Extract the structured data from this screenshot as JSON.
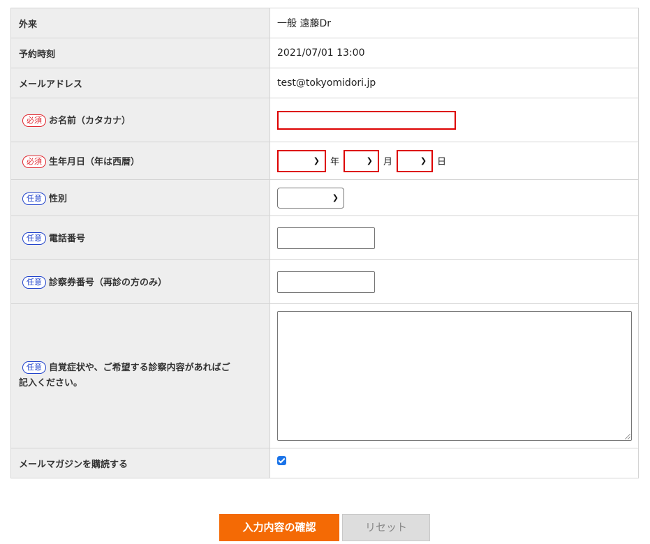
{
  "badges": {
    "required": "必須",
    "optional": "任意"
  },
  "rows": {
    "outpatient": {
      "label": "外来",
      "value": "一般 遠藤Dr"
    },
    "appointment_time": {
      "label": "予約時刻",
      "value": "2021/07/01 13:00"
    },
    "email": {
      "label": "メールアドレス",
      "value": "test@tokyomidori.jp"
    },
    "name_kana": {
      "label": "お名前（カタカナ）",
      "value": ""
    },
    "birthdate": {
      "label": "生年月日（年は西暦）",
      "year_unit": "年",
      "month_unit": "月",
      "day_unit": "日"
    },
    "gender": {
      "label": "性別"
    },
    "phone": {
      "label": "電話番号",
      "value": ""
    },
    "patient_card": {
      "label": "診察券番号（再診の方のみ）",
      "value": ""
    },
    "symptoms": {
      "label_line1": "自覚症状や、ご希望する診察内容があればご",
      "label_line2": "記入ください。",
      "value": ""
    },
    "newsletter": {
      "label": "メールマガジンを購読する",
      "checked": true
    }
  },
  "buttons": {
    "confirm": "入力内容の確認",
    "reset": "リセット"
  },
  "colors": {
    "primary": "#f46a05",
    "required": "#e0262e",
    "optional": "#2244cc",
    "label_bg": "#eeeeee"
  }
}
